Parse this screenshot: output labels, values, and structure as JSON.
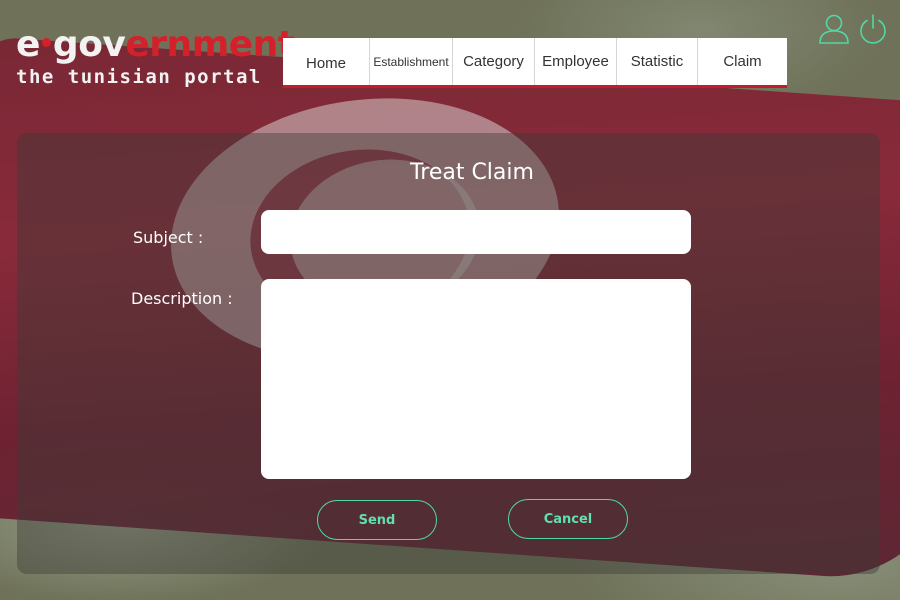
{
  "logo": {
    "prefix": "e",
    "white_part": "gov",
    "red_part": "ernment",
    "tagline": "the tunisian portal"
  },
  "nav": {
    "items": [
      {
        "label": "Home"
      },
      {
        "label": "Establishment"
      },
      {
        "label": "Category"
      },
      {
        "label": "Employee"
      },
      {
        "label": "Statistic"
      },
      {
        "label": "Claim"
      }
    ]
  },
  "top_icons": {
    "user": "user-icon",
    "power": "power-icon",
    "color": "#4fd9a5"
  },
  "form": {
    "title": "Treat Claim",
    "subject_label": "Subject :",
    "subject_value": "",
    "description_label": "Description :",
    "description_value": "",
    "send_label": "Send",
    "cancel_label": "Cancel"
  },
  "colors": {
    "accent": "#4fd9a5",
    "nav_underline": "#c01c2a",
    "logo_red": "#d4202a"
  }
}
